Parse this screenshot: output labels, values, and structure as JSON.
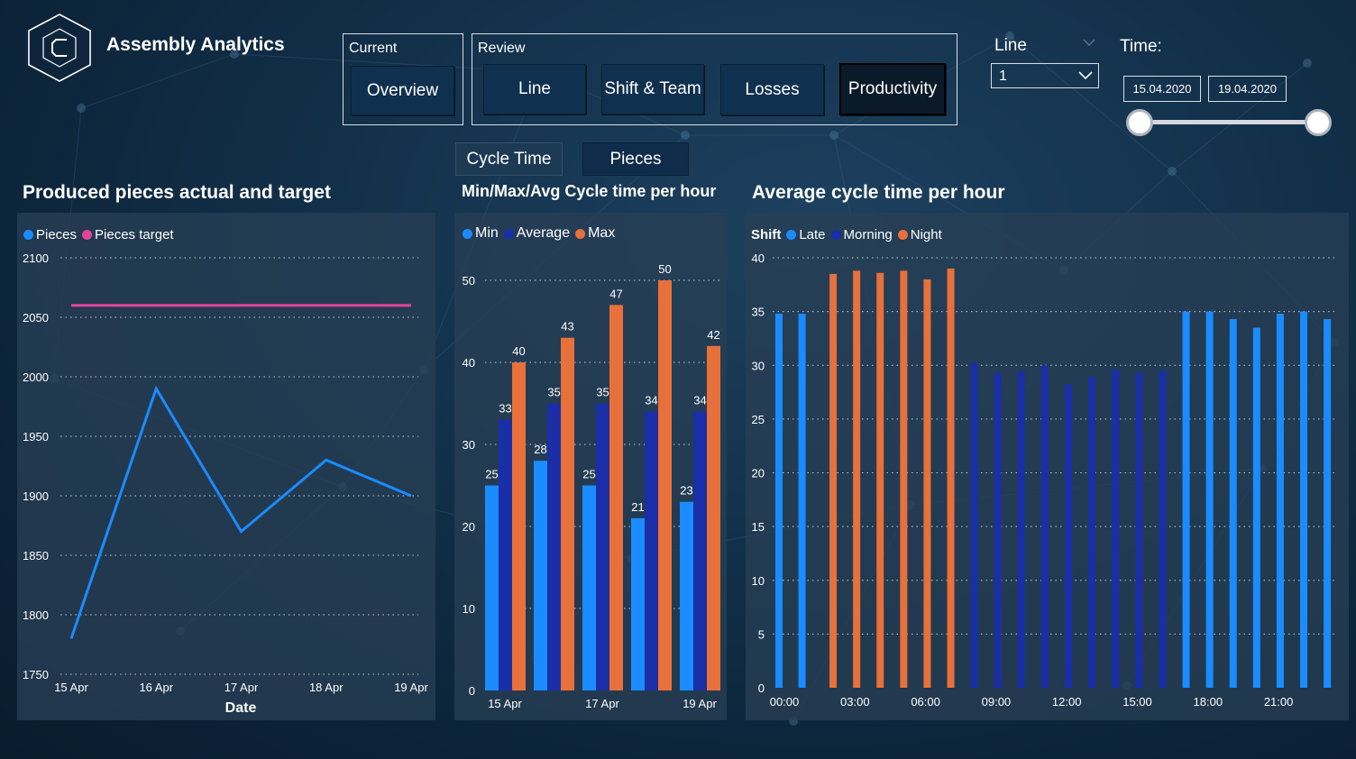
{
  "app": {
    "title": "Assembly Analytics",
    "logo_icon": "hexagon-c-logo-icon"
  },
  "nav": {
    "current_label": "Current",
    "current_buttons": [
      "Overview"
    ],
    "review_label": "Review",
    "review_buttons": [
      "Line",
      "Shift & Team",
      "Losses",
      "Productivity"
    ],
    "active_button": "Productivity"
  },
  "filters": {
    "line_label": "Line",
    "line_value": "1",
    "time_label": "Time:",
    "date_start": "15.04.2020",
    "date_end": "19.04.2020"
  },
  "sub_tabs": {
    "items": [
      "Cycle Time",
      "Pieces"
    ],
    "active": "Pieces"
  },
  "colors": {
    "pieces": "#1a8cff",
    "target": "#e3439c",
    "min": "#1a8cff",
    "average": "#1a2ea8",
    "max": "#e8703a",
    "late": "#1a8cff",
    "morning": "#1a2ea8",
    "night": "#e8703a"
  },
  "charts": {
    "produced": {
      "title": "Produced pieces actual and target",
      "legend": [
        "Pieces",
        "Pieces target"
      ]
    },
    "cycle": {
      "title": "Min/Max/Avg Cycle time per hour",
      "legend": [
        "Min",
        "Average",
        "Max"
      ]
    },
    "avg": {
      "title": "Average cycle time per hour",
      "legend_title": "Shift",
      "legend": [
        "Late",
        "Morning",
        "Night"
      ]
    }
  },
  "chart_data": [
    {
      "type": "line",
      "title": "Produced pieces actual and target",
      "xlabel": "Date",
      "ylabel": "",
      "categories": [
        "15 Apr",
        "16 Apr",
        "17 Apr",
        "18 Apr",
        "19 Apr"
      ],
      "series": [
        {
          "name": "Pieces",
          "values": [
            1780,
            1990,
            1870,
            1930,
            1900
          ]
        },
        {
          "name": "Pieces target",
          "values": [
            2060,
            2060,
            2060,
            2060,
            2060
          ]
        }
      ],
      "ylim": [
        1750,
        2100
      ],
      "yticks": [
        1750,
        1800,
        1850,
        1900,
        1950,
        2000,
        2050,
        2100
      ],
      "grid": true,
      "legend": "top-left"
    },
    {
      "type": "bar",
      "title": "Min/Max/Avg Cycle time per hour",
      "xlabel": "",
      "ylabel": "",
      "categories": [
        "15 Apr",
        "16 Apr",
        "17 Apr",
        "18 Apr",
        "19 Apr"
      ],
      "x_tick_labels": [
        "15 Apr",
        "",
        "17 Apr",
        "",
        "19 Apr"
      ],
      "series": [
        {
          "name": "Min",
          "values": [
            25,
            28,
            25,
            21,
            23
          ]
        },
        {
          "name": "Average",
          "values": [
            33,
            35,
            35,
            34,
            34
          ]
        },
        {
          "name": "Max",
          "values": [
            40,
            43,
            47,
            50,
            42
          ]
        }
      ],
      "ylim": [
        0,
        50
      ],
      "yticks": [
        0,
        10,
        20,
        30,
        40,
        50
      ],
      "data_labels": true,
      "grid": true,
      "legend": "top-left"
    },
    {
      "type": "bar",
      "title": "Average cycle time per hour",
      "xlabel": "",
      "ylabel": "",
      "categories": [
        "00:00",
        "01:00",
        "02:00",
        "03:00",
        "04:00",
        "05:00",
        "06:00",
        "07:00",
        "08:00",
        "09:00",
        "10:00",
        "11:00",
        "12:00",
        "13:00",
        "14:00",
        "15:00",
        "16:00",
        "17:00",
        "18:00",
        "19:00",
        "20:00",
        "21:00",
        "22:00",
        "23:00"
      ],
      "x_tick_labels": [
        "00:00",
        "03:00",
        "06:00",
        "09:00",
        "12:00",
        "15:00",
        "18:00",
        "21:00"
      ],
      "bars": [
        {
          "hour": 0,
          "value": 34.8,
          "shift": "Late"
        },
        {
          "hour": 0.98,
          "value": 34.8,
          "shift": "Late"
        },
        {
          "hour": 2.3,
          "value": 38.5,
          "shift": "Night"
        },
        {
          "hour": 3.3,
          "value": 38.8,
          "shift": "Night"
        },
        {
          "hour": 4.3,
          "value": 38.6,
          "shift": "Night"
        },
        {
          "hour": 5.3,
          "value": 38.8,
          "shift": "Night"
        },
        {
          "hour": 6.3,
          "value": 38.0,
          "shift": "Night"
        },
        {
          "hour": 7.3,
          "value": 39.0,
          "shift": "Night"
        },
        {
          "hour": 8.3,
          "value": 30.2,
          "shift": "Morning"
        },
        {
          "hour": 9.3,
          "value": 29.3,
          "shift": "Morning"
        },
        {
          "hour": 10.3,
          "value": 29.4,
          "shift": "Morning"
        },
        {
          "hour": 11.3,
          "value": 30.0,
          "shift": "Morning"
        },
        {
          "hour": 12.3,
          "value": 28.2,
          "shift": "Morning"
        },
        {
          "hour": 13.3,
          "value": 28.9,
          "shift": "Morning"
        },
        {
          "hour": 14.3,
          "value": 29.6,
          "shift": "Morning"
        },
        {
          "hour": 15.3,
          "value": 29.3,
          "shift": "Morning"
        },
        {
          "hour": 16.3,
          "value": 29.5,
          "shift": "Morning"
        },
        {
          "hour": 17.3,
          "value": 35.0,
          "shift": "Late"
        },
        {
          "hour": 18.3,
          "value": 35.0,
          "shift": "Late"
        },
        {
          "hour": 19.3,
          "value": 34.3,
          "shift": "Late"
        },
        {
          "hour": 20.3,
          "value": 33.5,
          "shift": "Late"
        },
        {
          "hour": 21.3,
          "value": 34.8,
          "shift": "Late"
        },
        {
          "hour": 22.3,
          "value": 35.0,
          "shift": "Late"
        },
        {
          "hour": 23.3,
          "value": 34.3,
          "shift": "Late"
        }
      ],
      "ylim": [
        0,
        40
      ],
      "yticks": [
        0,
        5,
        10,
        15,
        20,
        25,
        30,
        35,
        40
      ],
      "legend_title": "Shift",
      "legend_items": [
        "Late",
        "Morning",
        "Night"
      ],
      "grid": true,
      "legend": "top-left"
    }
  ]
}
